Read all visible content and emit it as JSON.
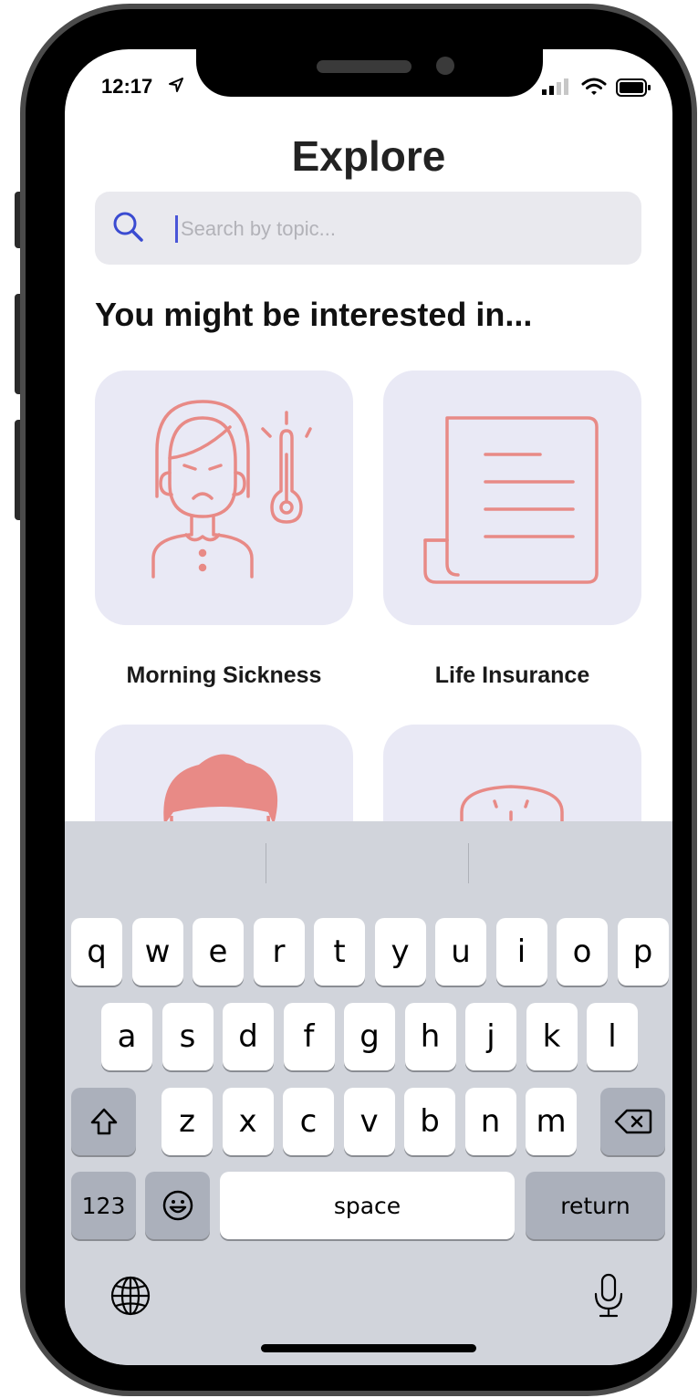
{
  "status_bar": {
    "time": "12:17"
  },
  "header": {
    "title": "Explore"
  },
  "search": {
    "placeholder": "Search by topic..."
  },
  "section": {
    "heading": "You might be interested in..."
  },
  "topics": [
    {
      "label": "Morning Sickness",
      "icon": "sick-person-thermometer-icon"
    },
    {
      "label": "Life Insurance",
      "icon": "document-scroll-icon"
    },
    {
      "label": "",
      "icon": "child-face-icon"
    },
    {
      "label": "",
      "icon": "toast-icon"
    }
  ],
  "colors": {
    "accent": "#e88a86",
    "card_bg": "#e9e9f5",
    "search_icon": "#3a4bd1",
    "keyboard_bg": "#d1d4db"
  },
  "keyboard": {
    "row1": [
      "q",
      "w",
      "e",
      "r",
      "t",
      "y",
      "u",
      "i",
      "o",
      "p"
    ],
    "row2": [
      "a",
      "s",
      "d",
      "f",
      "g",
      "h",
      "j",
      "k",
      "l"
    ],
    "row3": [
      "z",
      "x",
      "c",
      "v",
      "b",
      "n",
      "m"
    ],
    "numbers_label": "123",
    "space_label": "space",
    "return_label": "return"
  }
}
